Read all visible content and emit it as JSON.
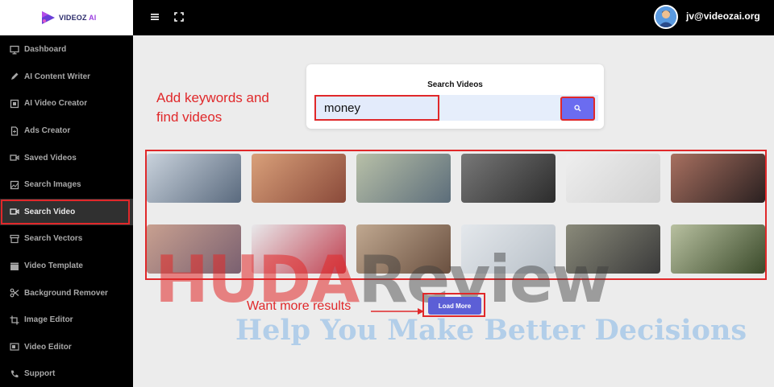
{
  "brand": {
    "name": "VIDEOZ",
    "suffix": "AI",
    "accent": "#9b3fe0"
  },
  "sidebar": {
    "items": [
      {
        "label": "Dashboard",
        "icon": "monitor-icon"
      },
      {
        "label": "AI Content Writer",
        "icon": "pen-icon"
      },
      {
        "label": "AI Video Creator",
        "icon": "film-icon"
      },
      {
        "label": "Ads Creator",
        "icon": "document-icon"
      },
      {
        "label": "Saved Videos",
        "icon": "video-camera-icon"
      },
      {
        "label": "Search Images",
        "icon": "image-icon"
      },
      {
        "label": "Search Video",
        "icon": "video-camera-icon",
        "active": true
      },
      {
        "label": "Search Vectors",
        "icon": "archive-icon"
      },
      {
        "label": "Video Template",
        "icon": "clapper-icon"
      },
      {
        "label": "Background Remover",
        "icon": "scissors-icon"
      },
      {
        "label": "Image Editor",
        "icon": "crop-icon"
      },
      {
        "label": "Video Editor",
        "icon": "video-edit-icon"
      },
      {
        "label": "Support",
        "icon": "phone-icon"
      }
    ]
  },
  "topbar": {
    "user_email": "jv@videozai.org"
  },
  "search": {
    "title": "Search Videos",
    "value": "money",
    "button_icon": "search-icon"
  },
  "annotations": {
    "keywords": "Add keywords and find videos",
    "more": "Want more results"
  },
  "results": [
    {
      "desc": "hands counting cash",
      "colors": [
        "#c9d2dc",
        "#5a6a7e"
      ]
    },
    {
      "desc": "euro banknotes",
      "colors": [
        "#d9a07a",
        "#8a4a3a"
      ]
    },
    {
      "desc": "stacked notes close-up",
      "colors": [
        "#b8c0a8",
        "#5c6d7a"
      ]
    },
    {
      "desc": "coins and notes",
      "colors": [
        "#787878",
        "#2c2c2c"
      ]
    },
    {
      "desc": "spinning coin",
      "colors": [
        "#eeeeee",
        "#d0d0d0"
      ]
    },
    {
      "desc": "coins dropping",
      "colors": [
        "#a87060",
        "#2a2020"
      ]
    },
    {
      "desc": "pile of banknotes",
      "colors": [
        "#c8a090",
        "#7a6070"
      ]
    },
    {
      "desc": "hand with red object",
      "colors": [
        "#e8e8ea",
        "#c04050"
      ]
    },
    {
      "desc": "woman at desk",
      "colors": [
        "#c0a890",
        "#6a5040"
      ]
    },
    {
      "desc": "handing money",
      "colors": [
        "#e4e8ec",
        "#b8c0c8"
      ]
    },
    {
      "desc": "counting dollar bills",
      "colors": [
        "#8a8a7a",
        "#3a3a3a"
      ]
    },
    {
      "desc": "dollar bills",
      "colors": [
        "#b8c0a0",
        "#3a4a2a"
      ]
    }
  ],
  "load_more": {
    "label": "Load More"
  },
  "watermark": {
    "main_left": "HUDA",
    "main_right": "Review",
    "sub": "Help You Make Better Decisions"
  },
  "colors": {
    "annotation": "#e0282a",
    "button": "#6b6cf0"
  }
}
